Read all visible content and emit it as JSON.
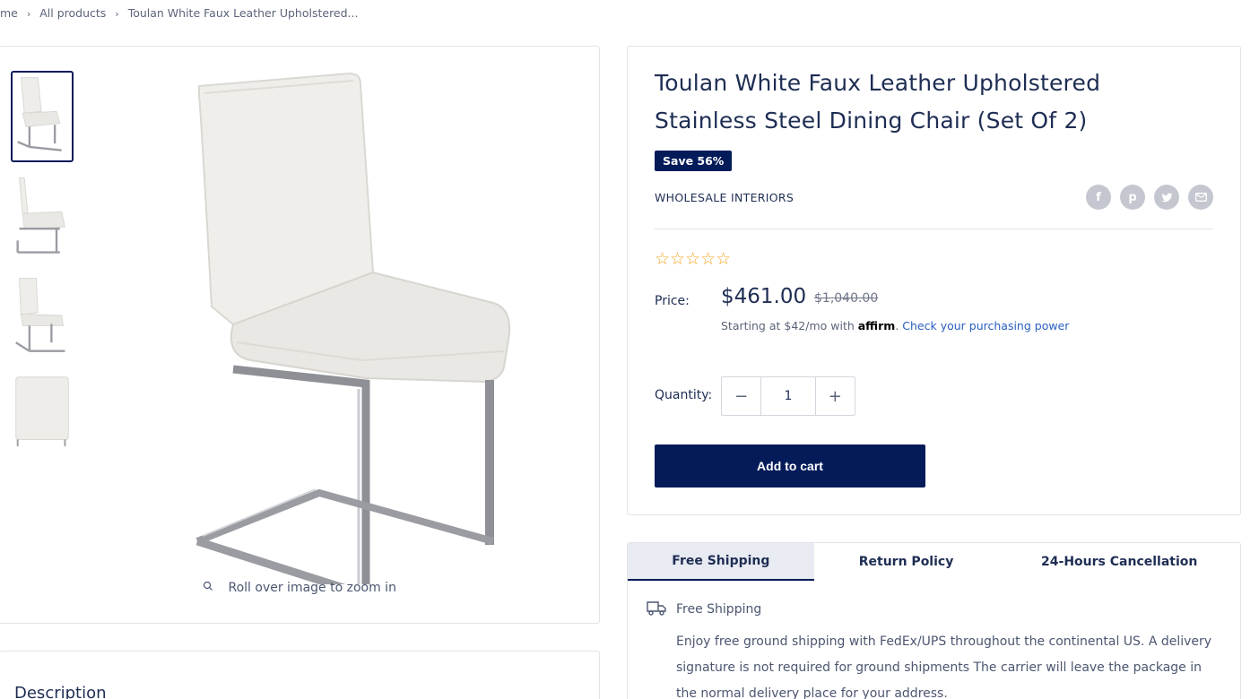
{
  "breadcrumb": {
    "home": "me",
    "all_products": "All products",
    "current": "Toulan White Faux Leather Upholstered..."
  },
  "gallery": {
    "thumbnails": [
      "thumbnail-1",
      "thumbnail-2",
      "thumbnail-3",
      "thumbnail-4"
    ],
    "zoom_hint": "Roll over image to zoom in"
  },
  "description": {
    "title": "Description"
  },
  "product": {
    "title": "Toulan White Faux Leather Upholstered Stainless Steel Dining Chair (Set Of 2)",
    "badge": "Save 56%",
    "vendor": "WHOLESALE INTERIORS",
    "share_icons": [
      "facebook-icon",
      "pinterest-icon",
      "twitter-icon",
      "email-icon"
    ],
    "rating": "☆☆☆☆☆",
    "price_label": "Price:",
    "price": "$461.00",
    "compare_price": "$1,040.00",
    "affirm": {
      "prefix": "Starting at $42/mo with ",
      "brand": "affirm",
      "suffix": ". ",
      "link": "Check your purchasing power"
    },
    "quantity_label": "Quantity:",
    "quantity": "1",
    "add_to_cart": "Add to cart"
  },
  "shipping": {
    "tabs": [
      {
        "label": "Free Shipping",
        "active": true
      },
      {
        "label": "Return Policy",
        "active": false
      },
      {
        "label": "24-Hours Cancellation",
        "active": false
      }
    ],
    "heading": "Free Shipping",
    "text": "Enjoy free ground shipping with FedEx/UPS throughout the continental US. A delivery signature is not required for ground shipments The carrier will leave the package in the normal delivery place for your address."
  },
  "colors": {
    "accent": "#041b5a",
    "text": "#1e2d53",
    "link": "#2a5fc2",
    "star": "#f5a623"
  }
}
